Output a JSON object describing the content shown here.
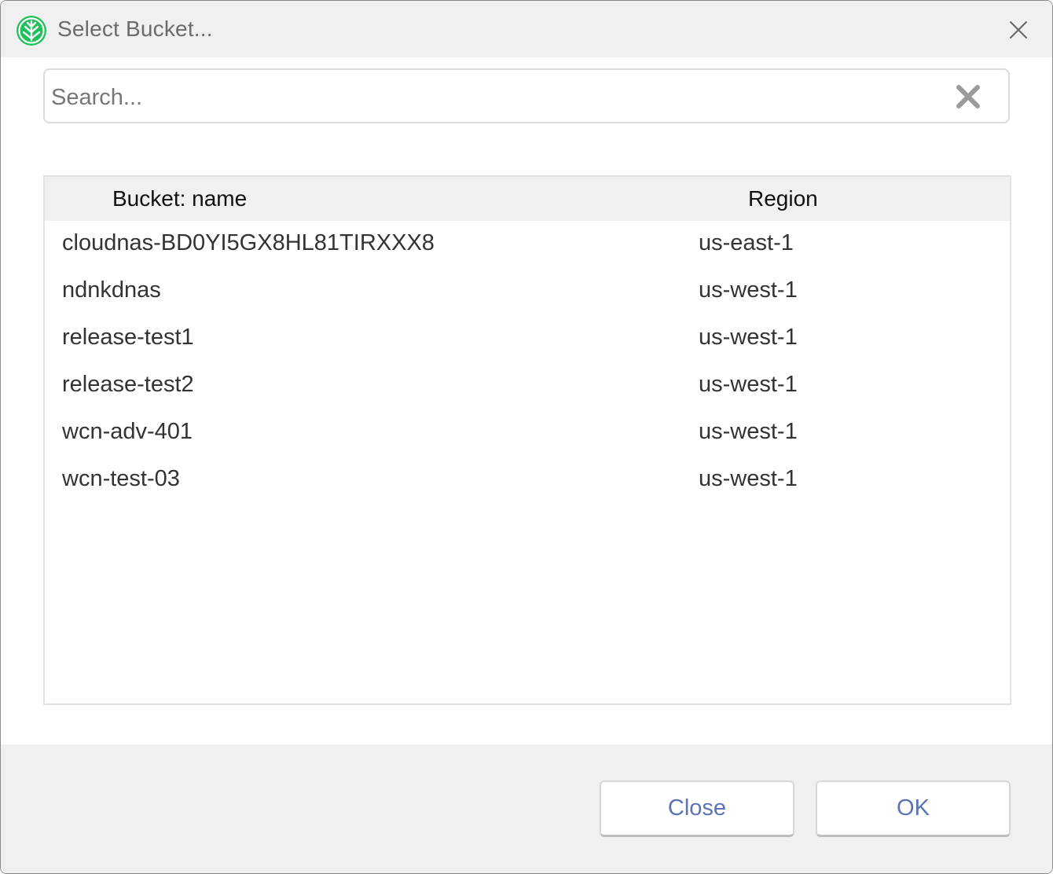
{
  "dialog": {
    "title": "Select Bucket...",
    "app_icon": "leaf-logo-icon",
    "close_icon": "close-icon",
    "accent_color": "#1fc25a"
  },
  "search": {
    "placeholder": "Search...",
    "value": "",
    "clear_icon": "clear-x-icon"
  },
  "table": {
    "columns": [
      "Bucket: name",
      "Region"
    ],
    "rows": [
      {
        "name": "cloudnas-BD0YI5GX8HL81TIRXXX8",
        "region": "us-east-1"
      },
      {
        "name": "ndnkdnas",
        "region": "us-west-1"
      },
      {
        "name": "release-test1",
        "region": "us-west-1"
      },
      {
        "name": "release-test2",
        "region": "us-west-1"
      },
      {
        "name": "wcn-adv-401",
        "region": "us-west-1"
      },
      {
        "name": "wcn-test-03",
        "region": "us-west-1"
      }
    ]
  },
  "buttons": {
    "close_label": "Close",
    "ok_label": "OK",
    "label_color": "#5b73b8"
  }
}
